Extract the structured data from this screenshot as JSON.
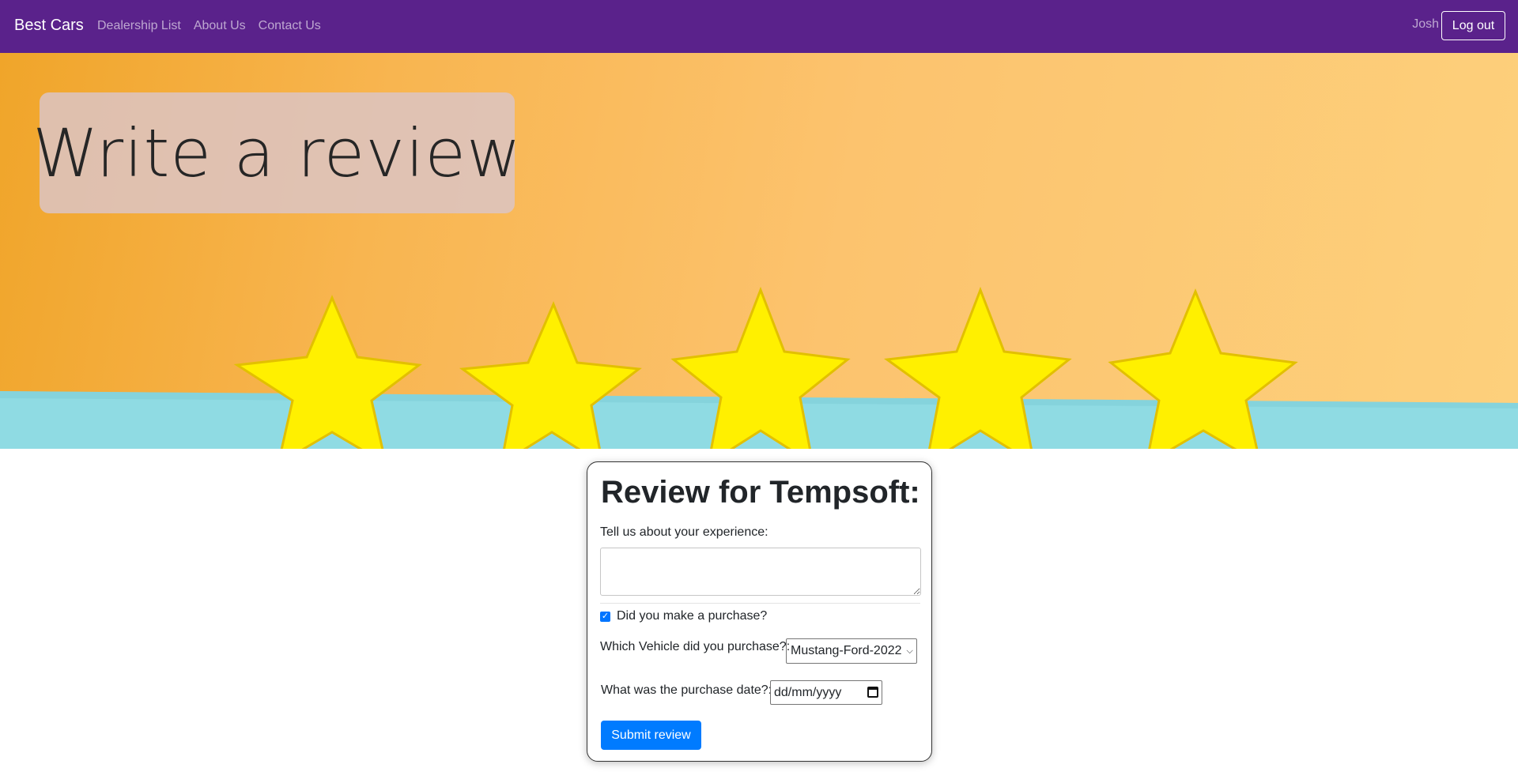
{
  "navbar": {
    "brand": "Best Cars",
    "links": [
      "Dealership List",
      "About Us",
      "Contact Us"
    ],
    "user": "Josh",
    "logout_label": "Log out",
    "bg_color": "#5a228b"
  },
  "hero": {
    "title": "Write a review",
    "image": "five-yellow-stars-on-orange-and-teal-background"
  },
  "review_form": {
    "title": "Review for Tempsoft:",
    "experience_label": "Tell us about your experience:",
    "experience_value": "",
    "purchase_checked": true,
    "purchase_label": "Did you make a purchase?",
    "vehicle_label": "Which Vehicle did you purchase?:",
    "vehicle_selected": "Mustang-Ford-2022",
    "date_label": "What was the purchase date?:",
    "date_placeholder": "dd/mm/yyyy",
    "submit_label": "Submit review",
    "submit_color": "#007bff"
  }
}
